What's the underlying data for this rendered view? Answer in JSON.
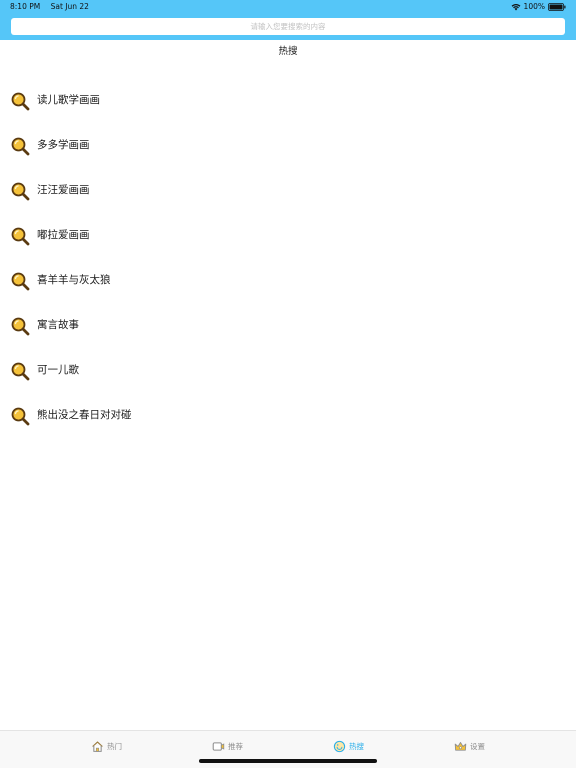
{
  "status_bar": {
    "time": "8:10 PM",
    "date": "Sat Jun 22",
    "battery": "100%"
  },
  "search": {
    "placeholder": "请输入您要搜索的内容"
  },
  "page": {
    "title": "热搜"
  },
  "hot_searches": [
    "读儿歌学画画",
    "多多学画画",
    "汪汪爱画画",
    "嘟拉爱画画",
    "喜羊羊与灰太狼",
    "寓言故事",
    "可一儿歌",
    "熊出没之春日对对碰"
  ],
  "tabs": [
    {
      "label": "热门",
      "icon": "home-icon",
      "active": false
    },
    {
      "label": "推荐",
      "icon": "video-icon",
      "active": false
    },
    {
      "label": "热搜",
      "icon": "hot-search-icon",
      "active": true
    },
    {
      "label": "设置",
      "icon": "crown-icon",
      "active": false
    }
  ],
  "colors": {
    "header": "#55c6f8",
    "tab_active": "#2aaee9",
    "tab_inactive": "#8e8e8e",
    "magnifier_fill": "#f5c23a",
    "magnifier_stroke": "#5a3a10"
  }
}
